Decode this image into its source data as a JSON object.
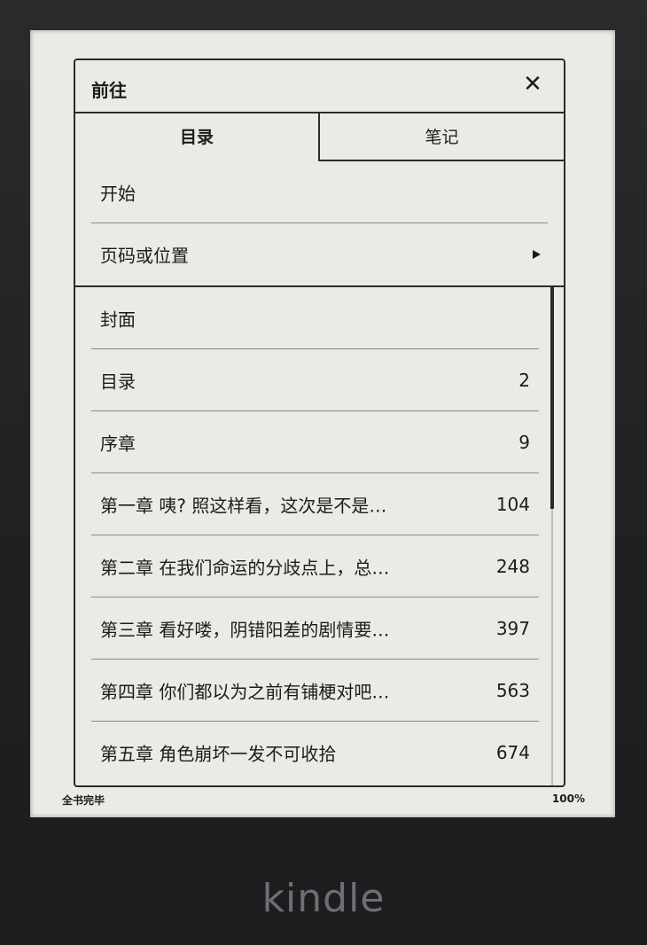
{
  "dialog": {
    "title": "前往",
    "close_label": "✕",
    "tabs": [
      {
        "label": "目录",
        "active": true
      },
      {
        "label": "笔记",
        "active": false
      }
    ]
  },
  "nav_items": [
    {
      "label": "开始"
    },
    {
      "label": "页码或位置",
      "has_submenu": true,
      "submenu_icon": "arrow-right-icon"
    }
  ],
  "toc": [
    {
      "label": "封面",
      "page": ""
    },
    {
      "label": "目录",
      "page": "2"
    },
    {
      "label": "序章",
      "page": "9"
    },
    {
      "label": "第一章 咦? 照这样看，这次是不是…",
      "page": "104"
    },
    {
      "label": "第二章 在我们命运的分歧点上，总…",
      "page": "248"
    },
    {
      "label": "第三章 看好喽，阴错阳差的剧情要…",
      "page": "397"
    },
    {
      "label": "第四章 你们都以为之前有铺梗对吧…",
      "page": "563"
    },
    {
      "label": "第五章 角色崩坏一发不可收拾",
      "page": "674"
    }
  ],
  "status": {
    "left": "全书完毕",
    "right": "100%"
  },
  "device": {
    "brand": "kindle"
  }
}
